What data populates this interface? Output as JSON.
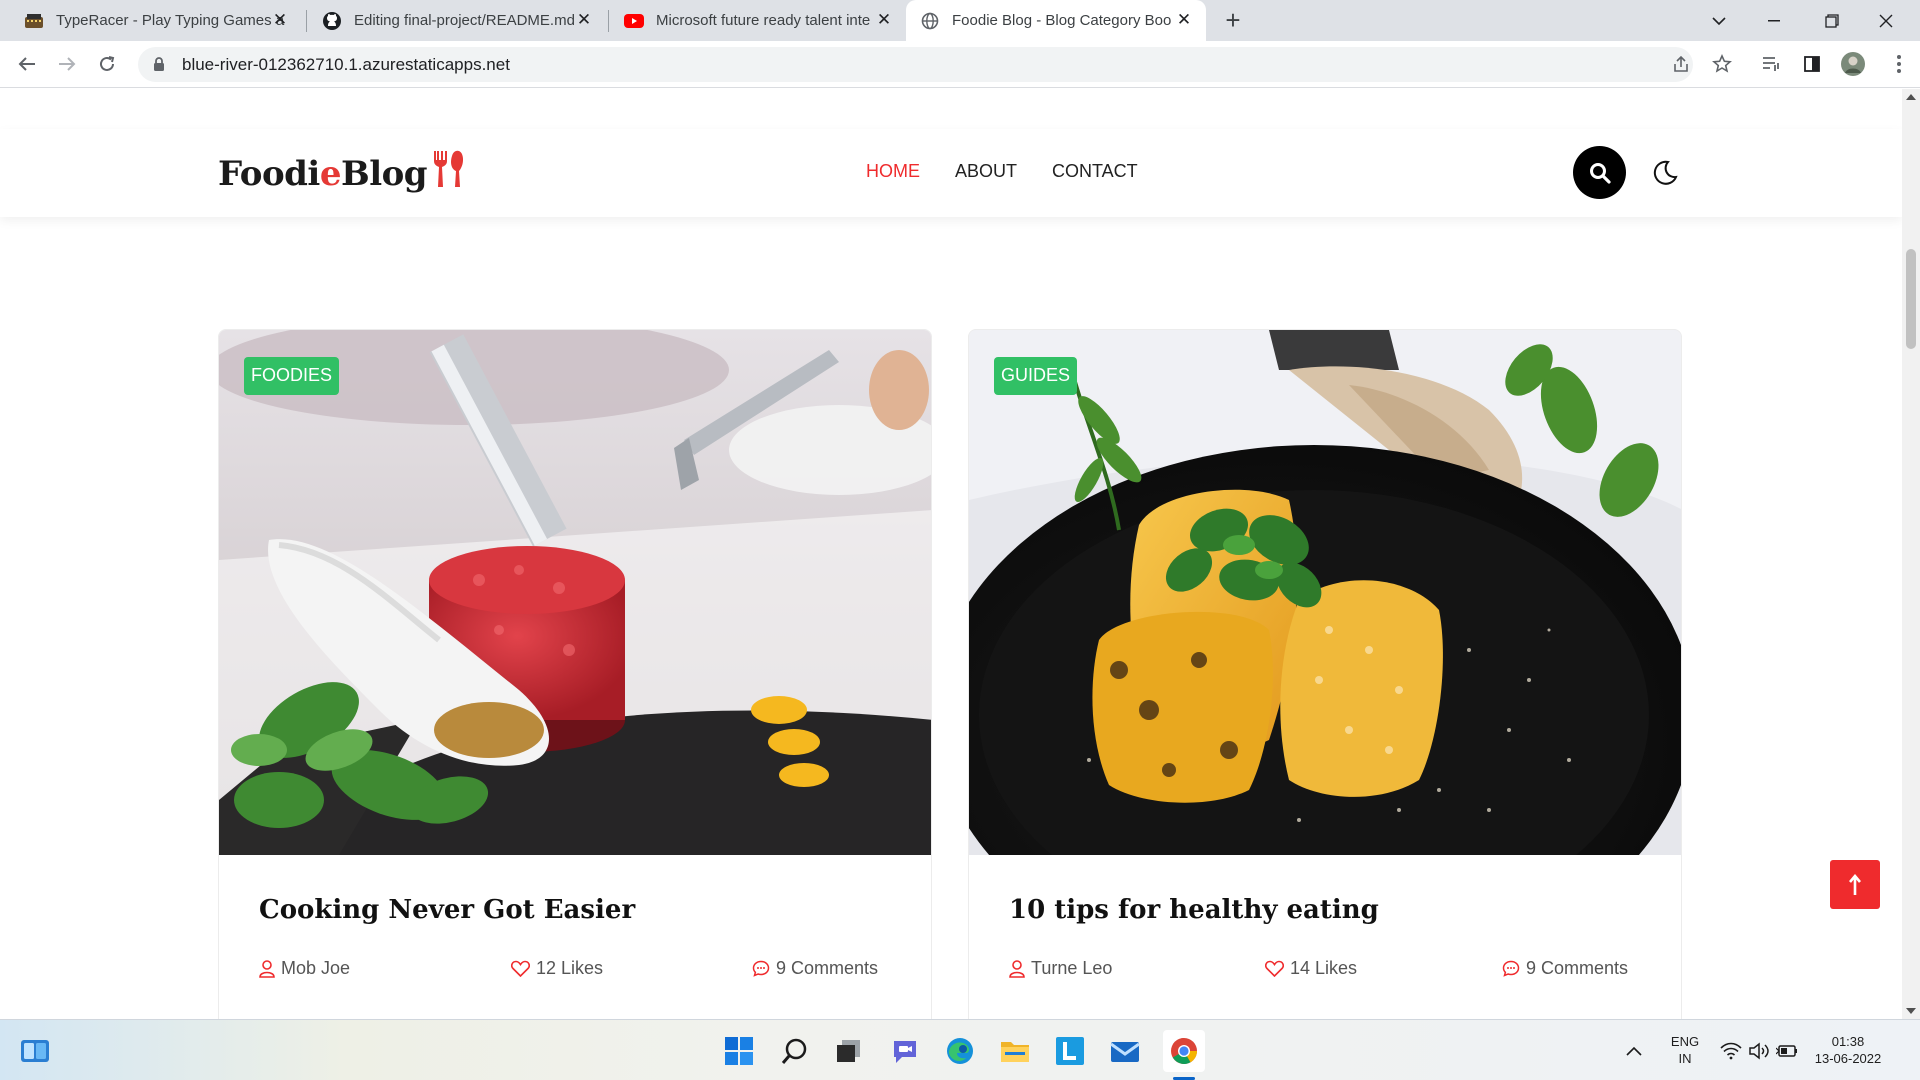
{
  "browser": {
    "tabs": [
      {
        "title": "TypeRacer - Play Typing Games a",
        "icon": "typeracer-icon",
        "active": false
      },
      {
        "title": "Editing final-project/README.md",
        "icon": "github-icon",
        "active": false
      },
      {
        "title": "Microsoft future ready talent inte",
        "icon": "youtube-icon",
        "active": false
      },
      {
        "title": "Foodie Blog - Blog Category Boo",
        "icon": "globe-icon",
        "active": true
      }
    ],
    "url": "blue-river-012362710.1.azurestaticapps.net"
  },
  "site": {
    "logo_part1": "Foodi",
    "logo_accent": "e",
    "logo_part2": " Blog",
    "nav": [
      {
        "label": "HOME",
        "active": true
      },
      {
        "label": "ABOUT",
        "active": false
      },
      {
        "label": "CONTACT",
        "active": false
      }
    ],
    "accent_color": "#ef2b2d",
    "badge_color": "#31c065"
  },
  "posts": [
    {
      "category": "FOODIES",
      "title": "Cooking Never Got Easier",
      "author": "Mob Joe",
      "likes": "12 Likes",
      "comments": "9 Comments"
    },
    {
      "category": "GUIDES",
      "title": "10 tips for healthy eating",
      "author": "Turne Leo",
      "likes": "14 Likes",
      "comments": "9 Comments"
    }
  ],
  "taskbar": {
    "language": "ENG",
    "region": "IN",
    "time": "01:38",
    "date": "13-06-2022"
  }
}
